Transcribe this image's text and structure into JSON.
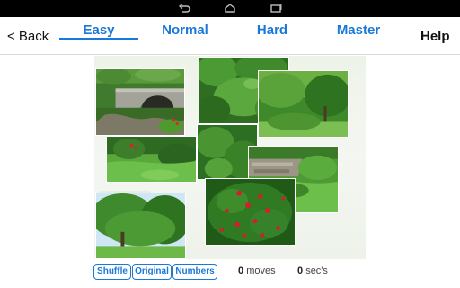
{
  "system_bar": {
    "icons": [
      "back-nav-icon",
      "home-nav-icon",
      "recent-apps-icon"
    ]
  },
  "header": {
    "back_label": "< Back",
    "tabs": [
      {
        "label": "Easy",
        "selected": true
      },
      {
        "label": "Normal",
        "selected": false
      },
      {
        "label": "Hard",
        "selected": false
      },
      {
        "label": "Master",
        "selected": false
      }
    ],
    "help_label": "Help",
    "accent_color": "#1a78d8"
  },
  "board": {
    "tiles": [
      {
        "subject": "stone-arch-bridge"
      },
      {
        "subject": "dense-green-shrubs"
      },
      {
        "subject": "sunlit-trees-hedge"
      },
      {
        "subject": "lawn-with-bushes"
      },
      {
        "subject": "green-foliage"
      },
      {
        "subject": "rock-wall-garden"
      },
      {
        "subject": "red-flowering-shrub"
      },
      {
        "subject": "tall-green-trees"
      }
    ]
  },
  "footer": {
    "shuffle_label": "Shuffle",
    "original_label": "Original",
    "numbers_label": "Numbers",
    "moves_value": "0",
    "moves_unit": "moves",
    "secs_value": "0",
    "secs_unit": "sec's"
  }
}
